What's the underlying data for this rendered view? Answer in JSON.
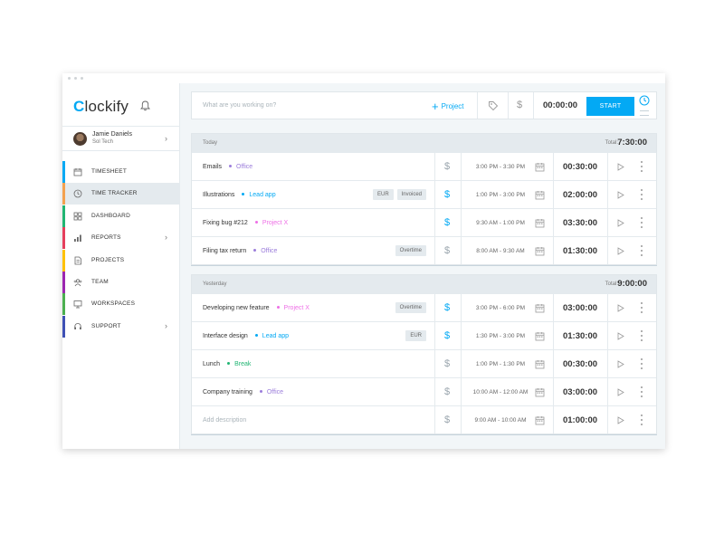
{
  "colors": {
    "accent": "#03a9f4",
    "office": "#9b7ddb",
    "lead_app": "#03a9f4",
    "project_x": "#ee6fe6",
    "break": "#21b573",
    "billable": "#03a9f4",
    "non_billable": "#9aa5ad"
  },
  "sidebar": {
    "logo_first": "C",
    "logo_rest": "lockify",
    "user": {
      "name": "Jamie Daniels",
      "company": "Sol Tech"
    },
    "items": [
      {
        "label": "TIMESHEET",
        "icon": "calendar-icon",
        "color": "#03a9f4"
      },
      {
        "label": "TIME TRACKER",
        "icon": "clock-icon",
        "color": "#f3a14f",
        "active": true
      },
      {
        "label": "DASHBOARD",
        "icon": "grid-icon",
        "color": "#21b573"
      },
      {
        "label": "REPORTS",
        "icon": "bar-chart-icon",
        "color": "#e53f5c",
        "chevron": true
      },
      {
        "label": "PROJECTS",
        "icon": "document-icon",
        "color": "#ffc107"
      },
      {
        "label": "TEAM",
        "icon": "team-icon",
        "color": "#9c27b0"
      },
      {
        "label": "WORKSPACES",
        "icon": "monitor-icon",
        "color": "#4caf50"
      },
      {
        "label": "SUPPORT",
        "icon": "headset-icon",
        "color": "#3f51b5",
        "chevron": true
      }
    ]
  },
  "timer": {
    "placeholder": "What are you working on?",
    "project_label": "Project",
    "time": "00:00:00",
    "start_label": "START"
  },
  "groups": [
    {
      "day": "Today",
      "total_label": "Total:",
      "total": "7:30:00",
      "entries": [
        {
          "desc": "Emails",
          "project": "Office",
          "project_color": "#9b7ddb",
          "badges": [],
          "billable": false,
          "range": "3:00 PM - 3:30 PM",
          "duration": "00:30:00"
        },
        {
          "desc": "Illustrations",
          "project": "Lead app",
          "project_color": "#03a9f4",
          "badges": [
            "EUR",
            "Invoiced"
          ],
          "billable": true,
          "range": "1:00 PM - 3:00 PM",
          "duration": "02:00:00"
        },
        {
          "desc": "Fixing bug #212",
          "project": "Project X",
          "project_color": "#ee6fe6",
          "badges": [],
          "billable": true,
          "range": "9:30 AM - 1:00 PM",
          "duration": "03:30:00"
        },
        {
          "desc": "Filing tax return",
          "project": "Office",
          "project_color": "#9b7ddb",
          "badges": [
            "Overtime"
          ],
          "billable": false,
          "range": "8:00 AM - 9:30 AM",
          "duration": "01:30:00"
        }
      ]
    },
    {
      "day": "Yesterday",
      "total_label": "Total:",
      "total": "9:00:00",
      "entries": [
        {
          "desc": "Developing new feature",
          "project": "Project X",
          "project_color": "#ee6fe6",
          "badges": [
            "Overtime"
          ],
          "billable": true,
          "range": "3:00 PM - 6:00 PM",
          "duration": "03:00:00"
        },
        {
          "desc": "Interface design",
          "project": "Lead app",
          "project_color": "#03a9f4",
          "badges": [
            "EUR"
          ],
          "billable": true,
          "range": "1:30 PM - 3:00 PM",
          "duration": "01:30:00"
        },
        {
          "desc": "Lunch",
          "project": "Break",
          "project_color": "#21b573",
          "badges": [],
          "billable": false,
          "range": "1:00 PM - 1:30 PM",
          "duration": "00:30:00"
        },
        {
          "desc": "Company training",
          "project": "Office",
          "project_color": "#9b7ddb",
          "badges": [],
          "billable": false,
          "range": "10:00 AM - 12:00 AM",
          "duration": "03:00:00"
        },
        {
          "desc": "Add description",
          "project": "",
          "project_color": "",
          "badges": [],
          "billable": false,
          "range": "9:00 AM - 10:00 AM",
          "duration": "01:00:00",
          "placeholder": true
        }
      ]
    }
  ]
}
